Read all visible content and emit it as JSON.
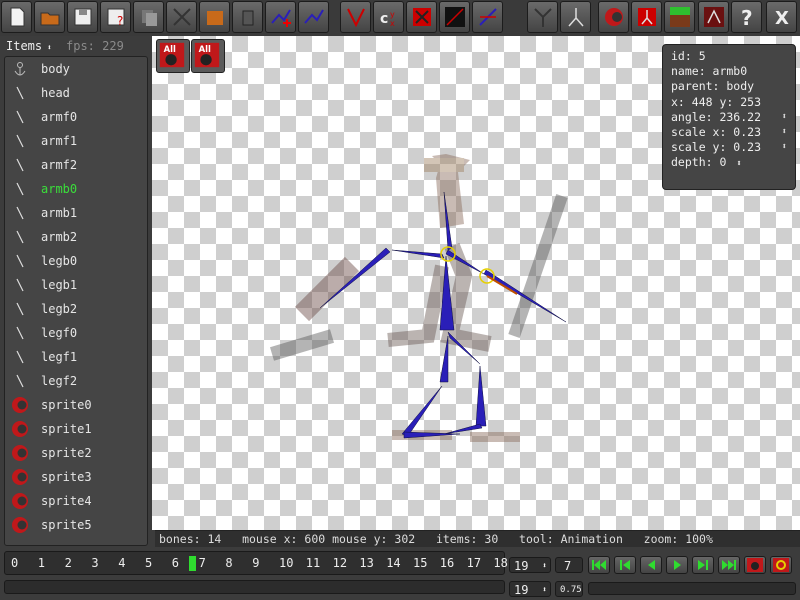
{
  "sidebar": {
    "header_label": "Items",
    "fps_label": "fps: 229",
    "items": [
      {
        "label": "body",
        "icon": "bone-anchor-icon"
      },
      {
        "label": "head",
        "icon": "bone-icon"
      },
      {
        "label": "armf0",
        "icon": "bone-icon"
      },
      {
        "label": "armf1",
        "icon": "bone-icon"
      },
      {
        "label": "armf2",
        "icon": "bone-icon"
      },
      {
        "label": "armb0",
        "icon": "bone-icon",
        "selected": true
      },
      {
        "label": "armb1",
        "icon": "bone-icon"
      },
      {
        "label": "armb2",
        "icon": "bone-icon"
      },
      {
        "label": "legb0",
        "icon": "bone-icon"
      },
      {
        "label": "legb1",
        "icon": "bone-icon"
      },
      {
        "label": "legb2",
        "icon": "bone-icon"
      },
      {
        "label": "legf0",
        "icon": "bone-icon"
      },
      {
        "label": "legf1",
        "icon": "bone-icon"
      },
      {
        "label": "legf2",
        "icon": "bone-icon"
      },
      {
        "label": "sprite0",
        "icon": "sprite-icon"
      },
      {
        "label": "sprite1",
        "icon": "sprite-icon"
      },
      {
        "label": "sprite2",
        "icon": "sprite-icon"
      },
      {
        "label": "sprite3",
        "icon": "sprite-icon"
      },
      {
        "label": "sprite4",
        "icon": "sprite-icon"
      },
      {
        "label": "sprite5",
        "icon": "sprite-icon"
      }
    ]
  },
  "canvas": {
    "all_button_1": "All",
    "all_button_2": "All"
  },
  "info": {
    "id": "id: 5",
    "name": "name: armb0",
    "parent": "parent: body",
    "xy": "x: 448  y: 253",
    "angle": "angle: 236.22",
    "scale_x": "scale x: 0.23",
    "scale_y": "scale y: 0.23",
    "depth": "depth: 0"
  },
  "status": "bones: 14   mouse x: 600 mouse y: 302   items: 30   tool: Animation   zoom: 100%",
  "timeline": {
    "ticks": [
      "0",
      "1",
      "2",
      "3",
      "4",
      "5",
      "6",
      "7",
      "8",
      "9",
      "10",
      "11",
      "12",
      "13",
      "14",
      "15",
      "16",
      "17",
      "18"
    ],
    "current_frame": 7,
    "frame_count_1": "19",
    "frame_count_2": "19",
    "current_frame_field": "7",
    "speed_field": "0.75"
  },
  "colors": {
    "selected_text": "#3adf3a",
    "bone_blue": "#2a1fb8",
    "frame_marker": "#2fdc2f",
    "icon_red": "#c0181a"
  }
}
